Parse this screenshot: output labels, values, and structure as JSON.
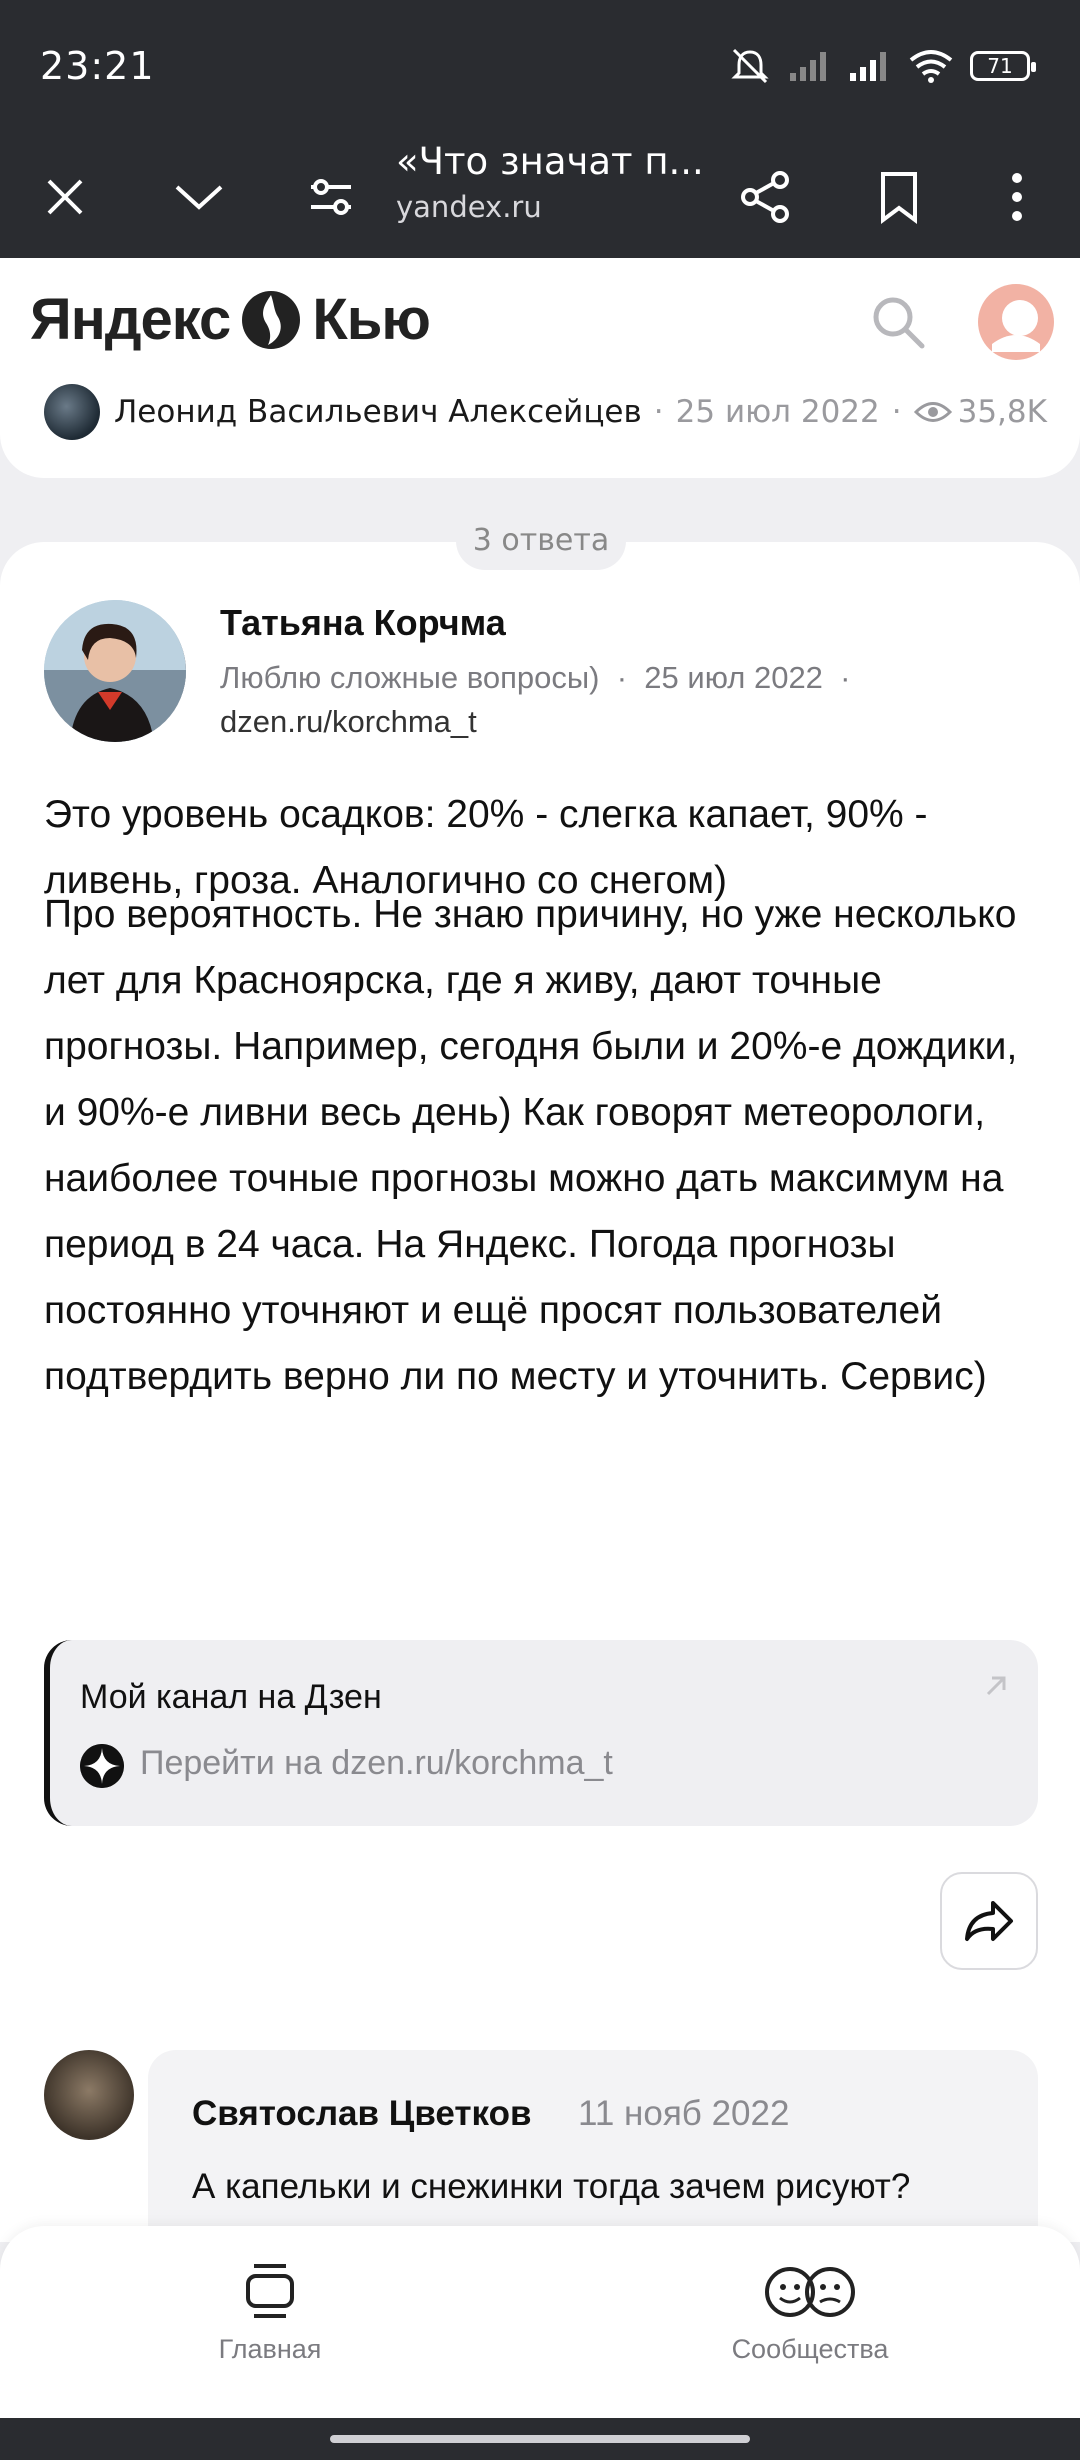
{
  "status_bar": {
    "time": "23:21",
    "battery": "71",
    "icons": [
      "mute-icon",
      "signal-icon",
      "signal-icon",
      "wifi-icon",
      "battery-icon"
    ]
  },
  "browser": {
    "title": "«Что значат п...",
    "domain": "yandex.ru",
    "icons": [
      "close-icon",
      "chevron-down-icon",
      "site-settings-icon",
      "share-icon",
      "bookmark-icon",
      "more-icon"
    ]
  },
  "site_header": {
    "logo_left": "Яндекс",
    "logo_right": "Кью",
    "icons": [
      "search-icon",
      "avatar"
    ]
  },
  "question": {
    "author": "Леонид Васильевич Алексейцев",
    "date": "25 июл 2022",
    "views": "35,8K"
  },
  "answers_count": "3 ответа",
  "answer": {
    "author_name": "Татьяна Корчма",
    "author_bio": "Люблю сложные вопросы)",
    "date": "25 июл 2022",
    "author_link": "dzen.ru/korchma_t",
    "paragraph1": "Это уровень осадков: 20% - слегка капает, 90% - ливень, гроза. Аналогично со снегом)",
    "paragraph2": "Про вероятность. Не знаю причину, но уже несколько лет для Красноярска, где я живу, дают точные прогнозы. Например, сегодня были и 20%-е дождики, и 90%-е ливни весь день) Как говорят метеорологи, наиболее точные прогнозы можно дать максимум на период в 24 часа. На Яндекс. Погода прогнозы постоянно уточняют и ещё просят пользователей подтвердить верно ли по месту и уточнить. Сервис)",
    "link_card": {
      "title": "Мой канал на Дзен",
      "url": "Перейти на dzen.ru/korchma_t"
    }
  },
  "comment": {
    "author": "Святослав Цветков",
    "date": "11 нояб 2022",
    "text": "А капельки и снежинки тогда зачем рисуют?"
  },
  "bottom_nav": {
    "home_label": "Главная",
    "communities_label": "Сообщества"
  }
}
